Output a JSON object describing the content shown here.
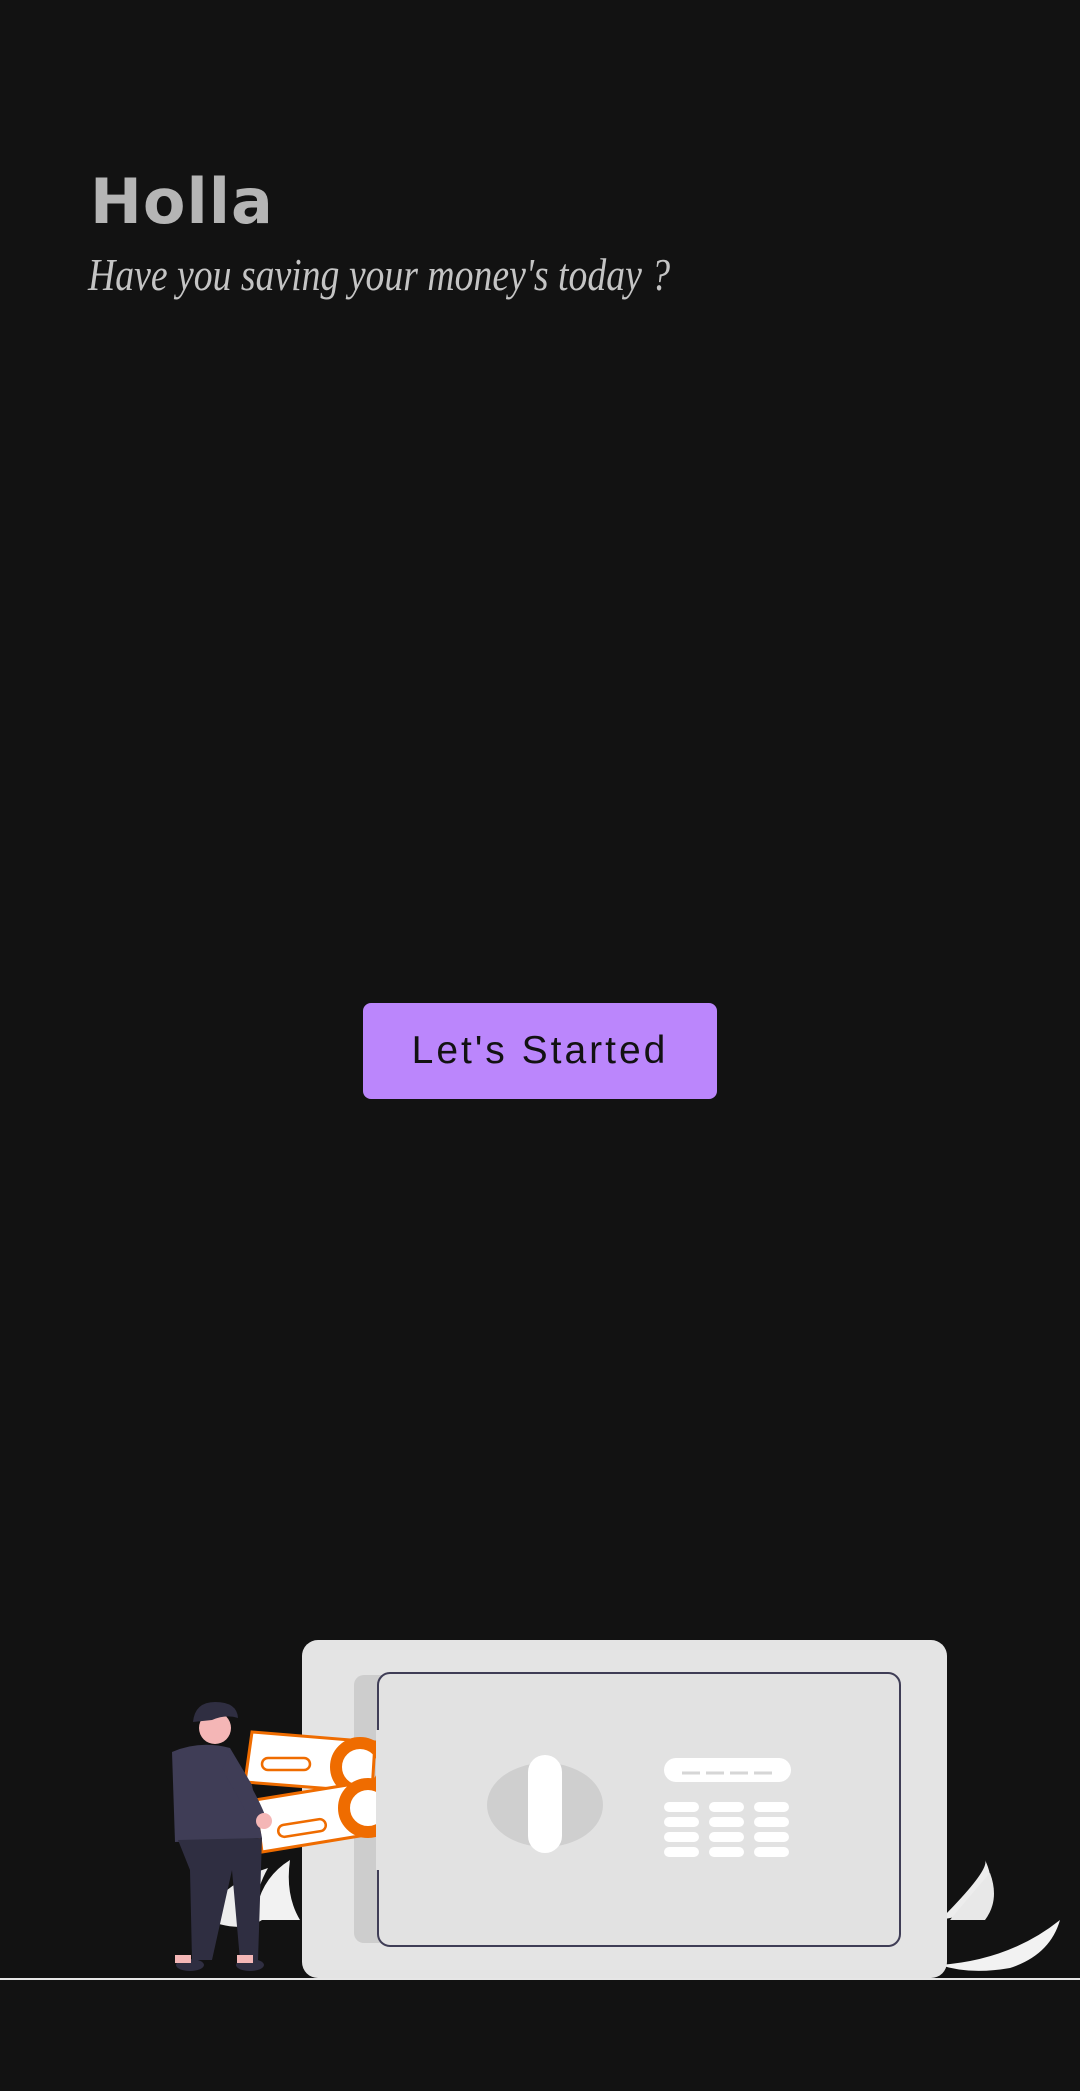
{
  "greeting": {
    "title": "Holla",
    "subtitle": "Have you saving your money's today ?"
  },
  "actions": {
    "start_label": "Let's Started"
  },
  "colors": {
    "background": "#121212",
    "primary": "#bb86fc",
    "accent_money": "#ef6c00"
  },
  "illustration": {
    "icon": "safe-with-person-depositing-money"
  }
}
